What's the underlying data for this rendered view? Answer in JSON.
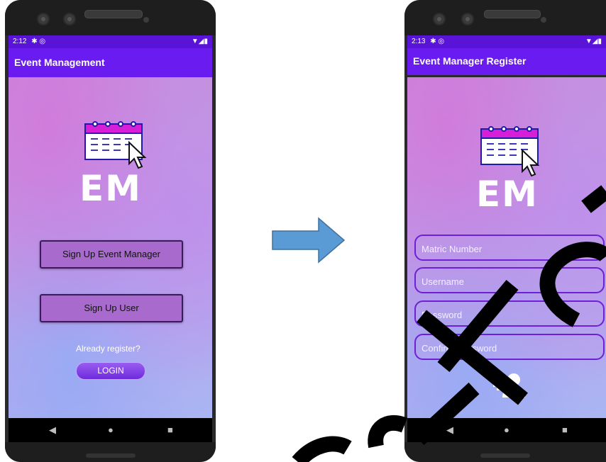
{
  "left_phone": {
    "status_time": "2:12",
    "status_icons": "✱ ◎",
    "status_right": "▼◢▮",
    "app_title": "Event Management",
    "logo_text": "EM",
    "buttons": {
      "event_manager": "Sign Up Event Manager",
      "user": "Sign Up User"
    },
    "already_register": "Already register?",
    "login": "LOGIN"
  },
  "right_phone": {
    "status_time": "2:13",
    "status_icons": "✱ ◎",
    "status_right": "▼◢▮",
    "app_title": "Event Manager Register",
    "logo_text": "EM",
    "fields": {
      "matric": "Matric Number",
      "username": "Username",
      "password": "Password",
      "confirm": "Confirm Password"
    }
  },
  "nav": {
    "back": "◀",
    "home": "●",
    "recents": "■"
  },
  "colors": {
    "app_bar": "#6a1cf0",
    "status_bar": "#5a14d8",
    "button_fill": "#a86acc",
    "arrow": "#5b9bd5"
  }
}
